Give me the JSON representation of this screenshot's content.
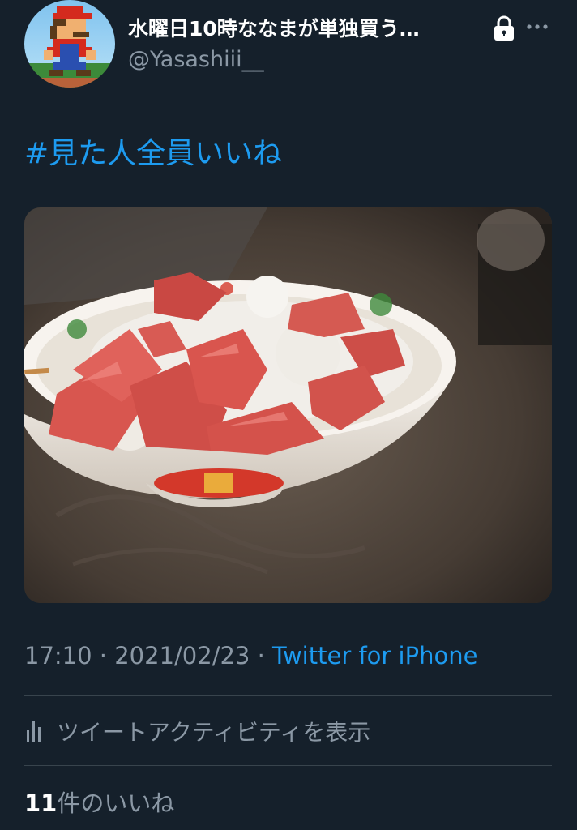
{
  "author": {
    "display_name": "水曜日10時ななまが単独買う…",
    "handle": "@Yasashiii__",
    "avatar_icon": "pixel-mario-avatar",
    "protected_icon": "lock-icon",
    "more_icon": "more-dots-icon"
  },
  "tweet": {
    "text": "#見た人全員いいね",
    "media_description": "",
    "time": "17:10",
    "separator": " · ",
    "date": "2021/02/23",
    "source": "Twitter for iPhone"
  },
  "activity": {
    "label": "ツイートアクティビティを表示",
    "icon": "bar-chart-icon"
  },
  "likes": {
    "count": "11",
    "label": "件のいいね"
  },
  "colors": {
    "background": "#15202b",
    "accent": "#1d9bf0",
    "secondary_text": "#8b98a5",
    "divider": "#38444d"
  }
}
